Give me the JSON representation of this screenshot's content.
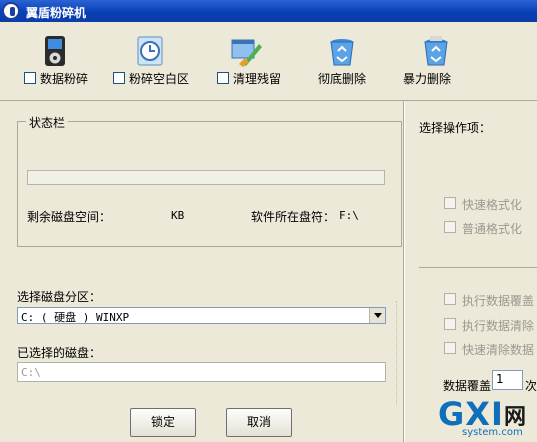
{
  "window": {
    "title": "翼盾粉碎机"
  },
  "toolbar": {
    "items": [
      {
        "label": "数据粉碎",
        "icon": "ipod-icon",
        "checkbox": true
      },
      {
        "label": "粉碎空白区",
        "icon": "clock-file-icon",
        "checkbox": true
      },
      {
        "label": "清理残留",
        "icon": "cleaning-brush-icon",
        "checkbox": true
      },
      {
        "label": "彻底删除",
        "icon": "recycle-bin-icon",
        "checkbox": false
      },
      {
        "label": "暴力删除",
        "icon": "recycle-bin-full-icon",
        "checkbox": false
      }
    ]
  },
  "status": {
    "legend": "状态栏",
    "free_space_label": "剩余磁盘空间：",
    "free_space_unit": "KB",
    "install_drive_label": "软件所在盘符：",
    "install_drive_value": "F:\\",
    "progress": 0
  },
  "partition": {
    "label": "选择磁盘分区：",
    "selected": "C: ( 硬盘 ) WINXP"
  },
  "selected_disk": {
    "label": "已选择的磁盘：",
    "value": "C:\\"
  },
  "buttons": {
    "lock": "锁定",
    "cancel": "取消"
  },
  "options": {
    "title": "选择操作项：",
    "format": [
      "快速格式化",
      "普通格式化"
    ],
    "data": [
      "执行数据覆盖",
      "执行数据清除",
      "快速清除数据"
    ],
    "overwrite_label": "数据覆盖",
    "overwrite_count": "1",
    "overwrite_unit": "次"
  },
  "watermark": {
    "logo": "GXI",
    "cn": "网",
    "url": "system.com"
  },
  "colors": {
    "titlebar": "#0a3fb6",
    "window_bg": "#ece9d8",
    "progress": "#3c8f3c"
  }
}
